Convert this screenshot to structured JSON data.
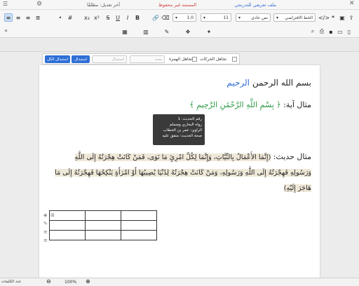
{
  "title_bar": {
    "doc_link": "ملف تعريفي للتدريجي",
    "unsaved": "المستند غير محفوظ",
    "last_edit": "آخر تعديل: مطلقًا"
  },
  "toolbar": {
    "font_family": "الخط الافتراضي",
    "font_size": "11",
    "paragraph_style": "نص عادي",
    "line_spacing": "1.0"
  },
  "find_bar": {
    "ignore_diacritics": "تجاهل الحركات",
    "ignore_hamza": "تجاهل الهمزة",
    "search_placeholder": "بحث",
    "replace_placeholder": "استبدال",
    "replace_button": "استبدال",
    "replace_all_button": "استبدال الكل"
  },
  "document": {
    "basmala_black": "بسم الله الرحمن ",
    "basmala_blue": "الرحيم",
    "ayah_label": "مثال آية: ",
    "ayah_text": "﴿ بِسْمِ اللَّهِ الرَّحْمَٰنِ الرَّحِيمِ ﴾",
    "hadith_label": "مثال حديث: ",
    "hadith_line1": "(إِنَّمَا الأَعْمَالُ بِالنِّيَّاتِ، وَإِنَّمَا لِكُلِّ امْرِئٍ مَا نَوَى، فَمَنْ كَانَتْ هِجْرَتُهُ إِلَى اللَّهِ",
    "hadith_line2": "وَرَسُولِهِ فَهِجْرَتُهُ إِلَى اللَّهِ وَرَسُولِهِ، وَمَنْ كَانَتْ هِجْرَتُهُ لِدُنْيَا يُصِيبُهَا أَوْ امْرَأَةٍ يَنْكِحُهَا فَهِجْرَتُهُ إِلَى مَا",
    "hadith_line3": "هَاجَرَ إِلَيْهِ)"
  },
  "tooltip": {
    "line1": "رقم الحديث: 1",
    "line2": "رواه البخاري ومسلم",
    "line3": "الراوي: عمر بن الخطاب",
    "line4": "صحة الحديث: متفق عليه"
  },
  "status_bar": {
    "word_count_label": "عدد الكلمات",
    "zoom": "100%"
  },
  "colors": {
    "accent": "#2f6fd6",
    "ayah_green": "#2f9a4a",
    "hadith_highlight": "#efe8d8"
  }
}
